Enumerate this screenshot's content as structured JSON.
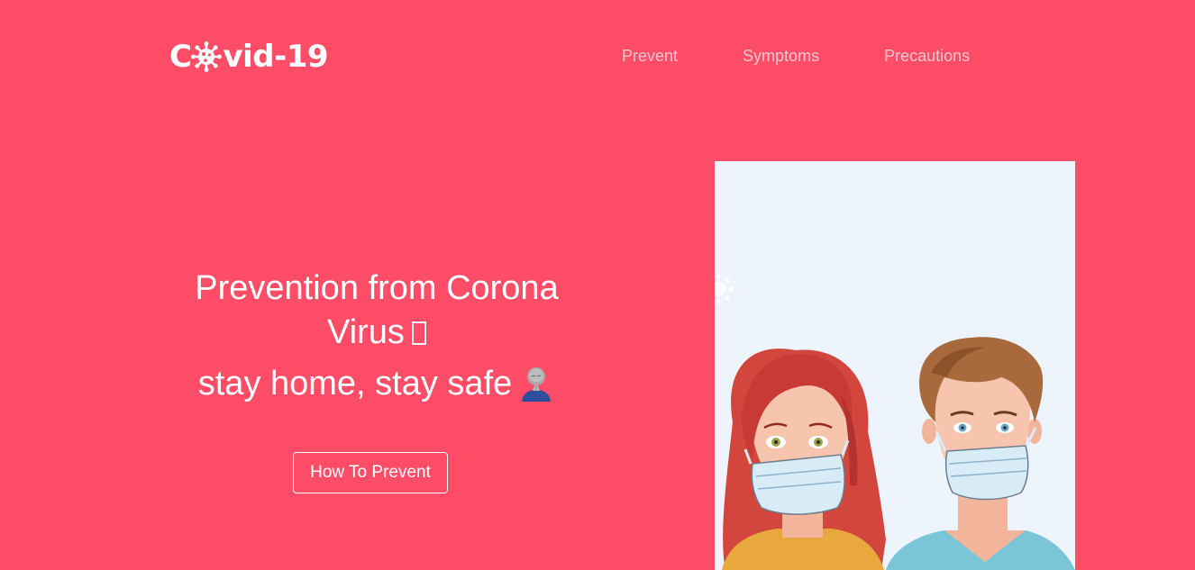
{
  "brand": {
    "logo_prefix": "C",
    "logo_suffix": "vid-19",
    "logo_icon": "virus-icon",
    "colors": {
      "background": "#ff4d67",
      "text": "#ffffff",
      "nav_text": "#f6c6cf",
      "illustration_bg": "#eef4fb"
    }
  },
  "nav": {
    "items": [
      {
        "label": "Prevent"
      },
      {
        "label": "Symptoms"
      },
      {
        "label": "Precautions"
      }
    ]
  },
  "hero": {
    "title_line1": "Prevention from Corona",
    "title_line2": "Virus",
    "subtitle": "stay home, stay safe",
    "cta_label": "How To Prevent"
  },
  "illustration": {
    "icon": "masked-people-illustration"
  }
}
